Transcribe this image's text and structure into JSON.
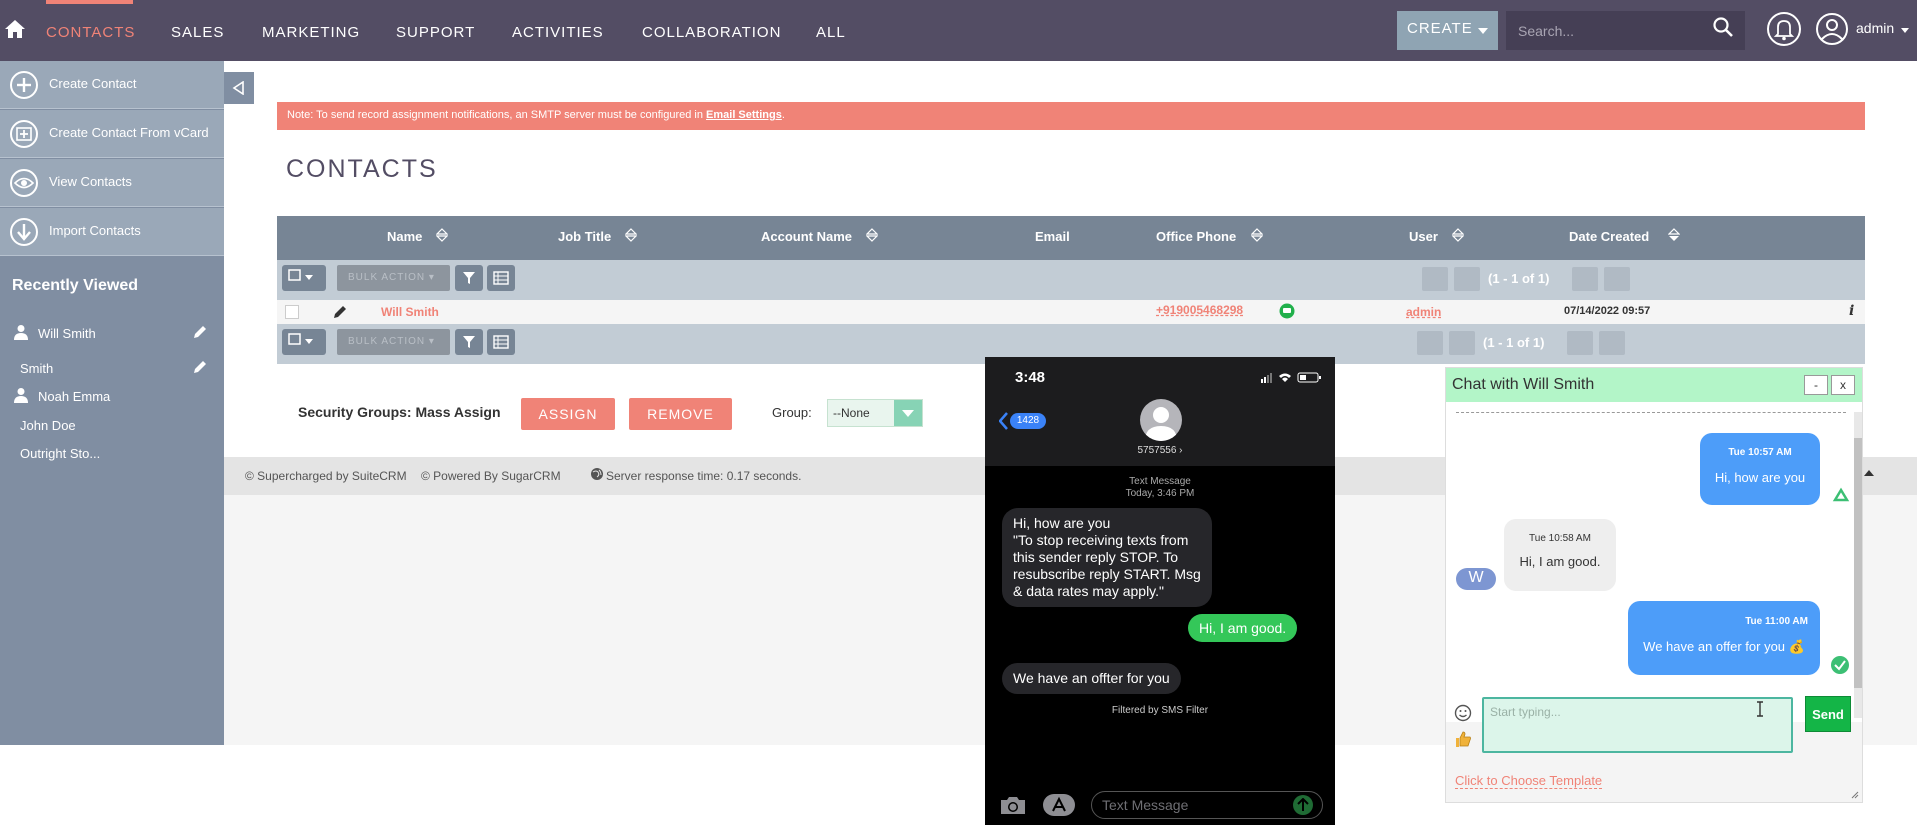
{
  "nav": {
    "items": [
      "CONTACTS",
      "SALES",
      "MARKETING",
      "SUPPORT",
      "ACTIVITIES",
      "COLLABORATION",
      "ALL"
    ],
    "create_label": "CREATE",
    "search_placeholder": "Search...",
    "user": "admin"
  },
  "sidebar": {
    "actions": [
      "Create Contact",
      "Create Contact From vCard",
      "View Contacts",
      "Import Contacts"
    ],
    "recent_title": "Recently Viewed",
    "recent": [
      "Will Smith",
      "Smith",
      "Noah Emma",
      "John Doe",
      "Outright Sto..."
    ]
  },
  "notice": {
    "text": "Note: To send record assignment notifications, an SMTP server must be configured in ",
    "link": "Email Settings",
    "end": "."
  },
  "page_title": "CONTACTS",
  "table": {
    "columns": [
      "Name",
      "Job Title",
      "Account Name",
      "Email",
      "Office Phone",
      "User",
      "Date Created"
    ],
    "bulk_label": "BULK ACTION",
    "pager": "(1 - 1 of 1)",
    "rows": [
      {
        "name": "Will Smith",
        "phone": "+919005468298",
        "user": "admin",
        "date": "07/14/2022 09:57"
      }
    ]
  },
  "security": {
    "label": "Security Groups: Mass Assign",
    "assign": "ASSIGN",
    "remove": "REMOVE",
    "group_label": "Group:",
    "group_value": "--None"
  },
  "footer": {
    "suitecrm": "© Supercharged by SuiteCRM",
    "sugar": "© Powered By SugarCRM",
    "response": "Server response time: 0.17 seconds."
  },
  "phone": {
    "time": "3:48",
    "back_count": "1428",
    "number": "5757556 ›",
    "meta_type": "Text Message",
    "meta_date": "Today, 3:46 PM",
    "messages": [
      {
        "dir": "in",
        "text": "Hi, how are you\n \"To stop receiving texts from this sender reply STOP. To resubscribe reply START. Msg & data rates may apply.\""
      },
      {
        "dir": "out",
        "text": "Hi, I am good."
      },
      {
        "dir": "in",
        "text": "We have an offter for you"
      }
    ],
    "filter_note": "Filtered by SMS Filter",
    "input_placeholder": "Text Message"
  },
  "chat": {
    "title": "Chat with Will Smith",
    "minimize": "-",
    "close": "x",
    "avatar_letter": "W",
    "messages": [
      {
        "dir": "out",
        "time": "Tue 10:57 AM",
        "text": "Hi, how are you"
      },
      {
        "dir": "in",
        "time": "Tue 10:58 AM",
        "text": "Hi, I am good."
      },
      {
        "dir": "out",
        "time": "Tue 11:00 AM",
        "text": "We have an offer for you 💰"
      }
    ],
    "input_placeholder": "Start typing...",
    "send_label": "Send",
    "template_link": "Click to Choose Template"
  },
  "colors": {
    "nav_bg": "#534d64",
    "accent": "#f08377",
    "sidebar_bg": "#808ea2",
    "chat_header": "#b3f5c8",
    "chat_send": "#14b547",
    "bubble_out": "#4d9df9",
    "sms_out": "#34c759"
  }
}
